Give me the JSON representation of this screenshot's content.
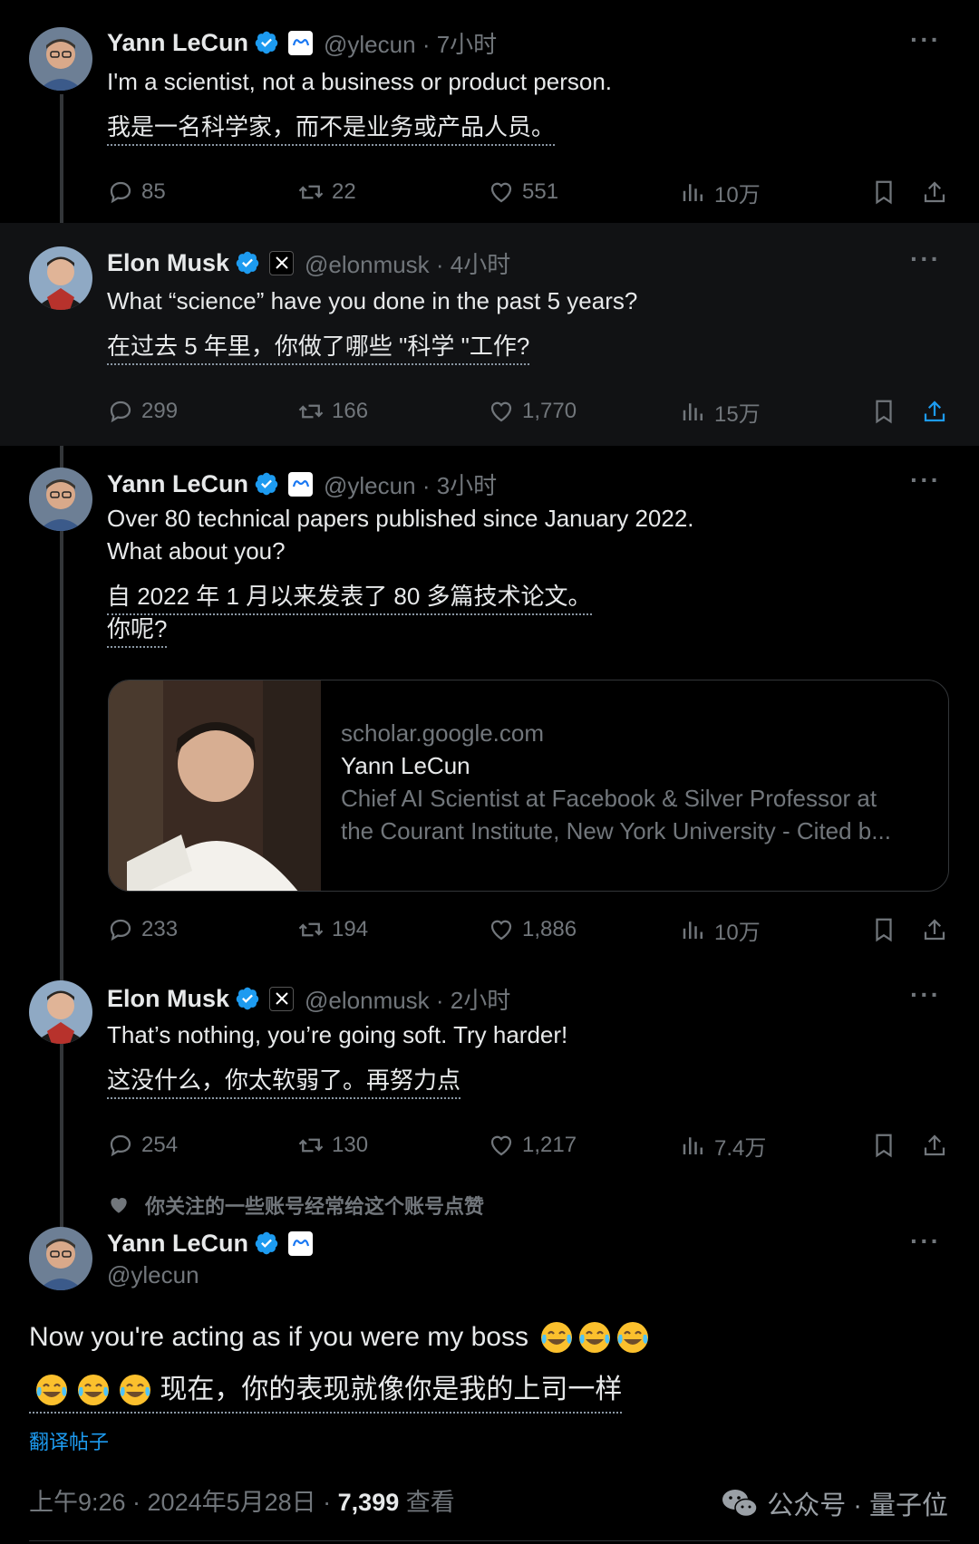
{
  "colors": {
    "background": "#000000",
    "accent": "#1d9bf0",
    "verified": "#1d9bf0",
    "muted": "#71767b"
  },
  "tweets": [
    {
      "name": "Yann LeCun",
      "handle": "@ylecun",
      "time": "· 7小时",
      "affiliation": "meta-logo",
      "text": [
        "I'm a scientist, not a business or product person."
      ],
      "translation": [
        "我是一名科学家，而不是业务或产品人员。"
      ],
      "stats": {
        "replies": "85",
        "retweets": "22",
        "likes": "551",
        "views": "10万"
      }
    },
    {
      "name": "Elon Musk",
      "handle": "@elonmusk",
      "time": "· 4小时",
      "affiliation": "x-logo",
      "text": [
        "What “science” have you done in the past 5 years?"
      ],
      "translation": [
        "在过去 5 年里，你做了哪些 \"科学 \"工作?"
      ],
      "stats": {
        "replies": "299",
        "retweets": "166",
        "likes": "1,770",
        "views": "15万"
      }
    },
    {
      "name": "Yann LeCun",
      "handle": "@ylecun",
      "time": "· 3小时",
      "affiliation": "meta-logo",
      "text": [
        "Over 80 technical papers published since January 2022.",
        "What about you?"
      ],
      "translation": [
        "自 2022 年 1 月以来发表了 80 多篇技术论文。",
        "你呢?"
      ],
      "card": {
        "domain": "scholar.google.com",
        "title": "Yann LeCun",
        "desc1": "Chief AI Scientist at Facebook & Silver Professor at",
        "desc2": "the Courant Institute, New York University - Cited b..."
      },
      "stats": {
        "replies": "233",
        "retweets": "194",
        "likes": "1,886",
        "views": "10万"
      }
    },
    {
      "name": "Elon Musk",
      "handle": "@elonmusk",
      "time": "· 2小时",
      "affiliation": "x-logo",
      "text": [
        "That’s nothing, you’re going soft. Try harder!"
      ],
      "translation": [
        "这没什么，你太软弱了。再努力点"
      ],
      "stats": {
        "replies": "254",
        "retweets": "130",
        "likes": "1,217",
        "views": "7.4万"
      }
    }
  ],
  "social_context": "你关注的一些账号经常给这个账号点赞",
  "main_tweet": {
    "name": "Yann LeCun",
    "handle": "@ylecun",
    "affiliation": "meta-logo",
    "text": "Now you're acting as if you were my boss",
    "translation": "现在，你的表现就像你是我的上司一样",
    "translate_link": "翻译帖子",
    "time": "上午9:26 · 2024年5月28日 · ",
    "views_count": "7,399",
    "views_label": " 查看"
  },
  "watermark": {
    "text": "公众号 · 量子位",
    "icon": "wechat-icon"
  }
}
